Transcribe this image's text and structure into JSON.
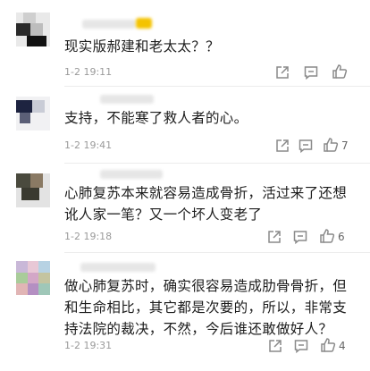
{
  "comments": [
    {
      "text": "现实版郝建和老太太？？",
      "time": "1-2 19:11",
      "likes": ""
    },
    {
      "text": "支持，不能寒了救人者的心。",
      "time": "1-2 19:41",
      "likes": "7"
    },
    {
      "text": "心肺复苏本来就容易造成骨折，活过来了还想讹人家一笔？又一个坏人变老了",
      "time": "1-2 19:18",
      "likes": "6"
    },
    {
      "text": "做心肺复苏时，确实很容易造成肋骨骨折，但和生命相比，其它都是次要的，所以，非常支持法院的裁决，不然，今后谁还敢做好人？",
      "time": "1-2 19:31",
      "likes": "4"
    }
  ],
  "icons": [
    "share-icon",
    "comment-icon",
    "like-icon"
  ],
  "colors": {
    "text": "#1c1c1c",
    "meta": "#9a9a9a",
    "icon": "#8a8a8a",
    "divider": "#ececec"
  }
}
